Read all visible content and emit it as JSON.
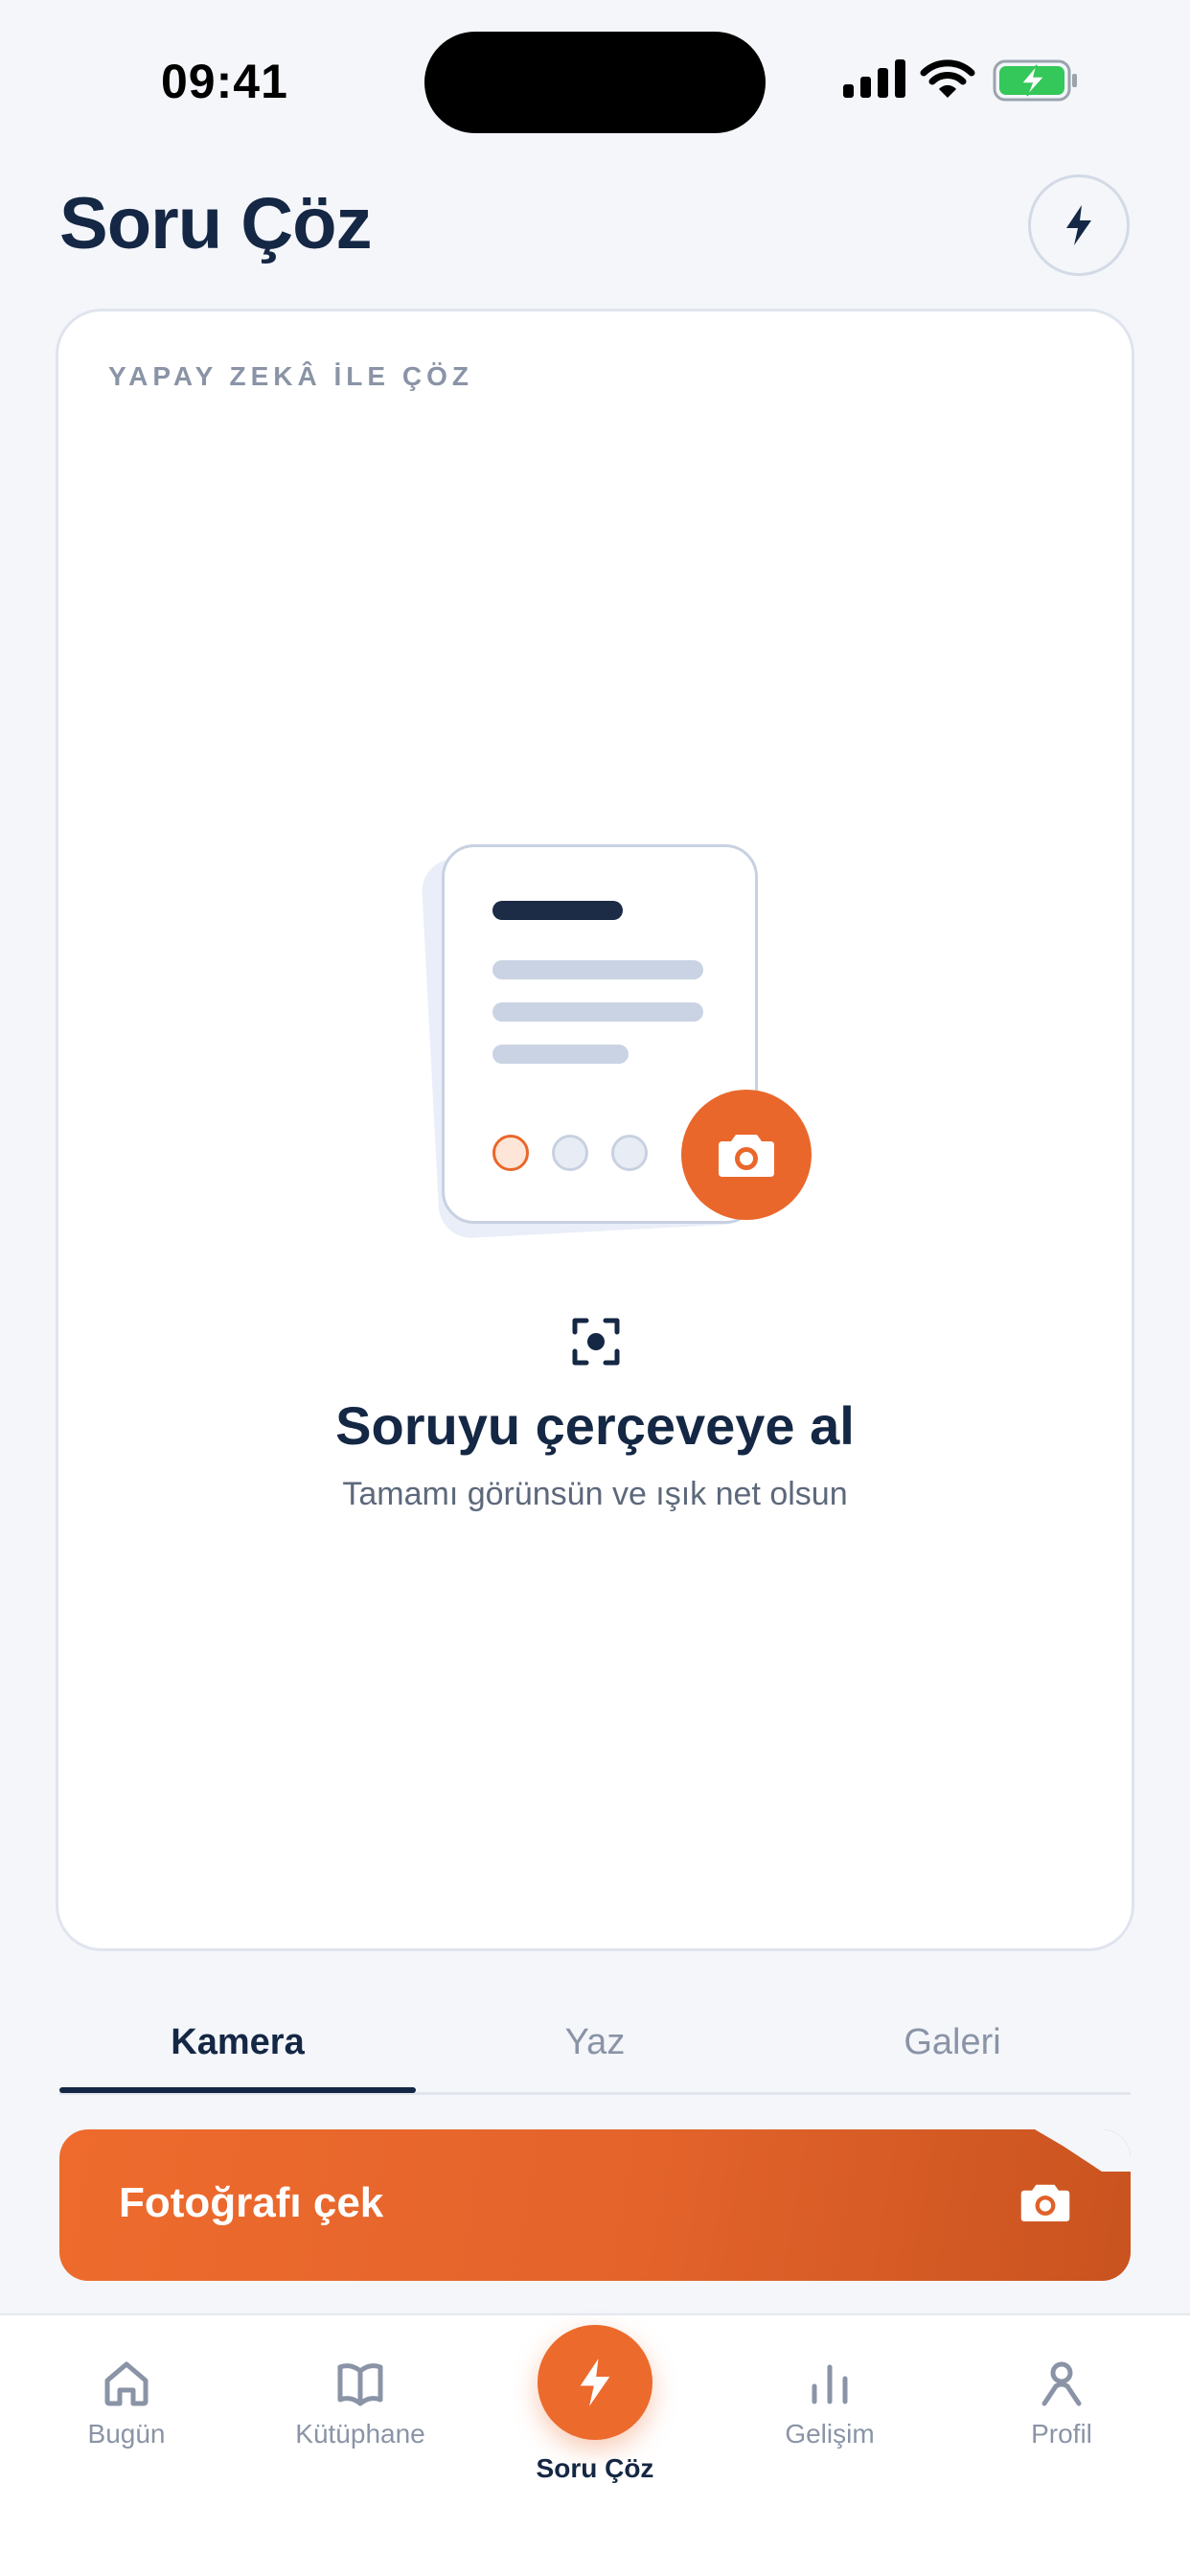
{
  "status_bar": {
    "time": "09:41"
  },
  "header": {
    "title": "Soru Çöz"
  },
  "card": {
    "eyebrow": "YAPAY ZEKÂ İLE ÇÖZ",
    "heading": "Soruyu çerçeveye al",
    "subtext": "Tamamı görünsün ve ışık net olsun"
  },
  "tabs": [
    {
      "label": "Kamera",
      "active": true
    },
    {
      "label": "Yaz",
      "active": false
    },
    {
      "label": "Galeri",
      "active": false
    }
  ],
  "capture_button": {
    "label": "Fotoğrafı çek",
    "icon": "camera-icon"
  },
  "bottom_nav": [
    {
      "label": "Bugün",
      "icon": "home-icon"
    },
    {
      "label": "Kütüphane",
      "icon": "book-icon"
    },
    {
      "label": "Soru Çöz",
      "icon": "bolt-icon",
      "active": true
    },
    {
      "label": "Gelişim",
      "icon": "bar-chart-icon"
    },
    {
      "label": "Profil",
      "icon": "person-icon"
    }
  ],
  "colors": {
    "accent": "#ec6a2c",
    "navy": "#142744",
    "muted": "#8a94a6",
    "background": "#f4f6fa",
    "battery": "#34c759"
  }
}
